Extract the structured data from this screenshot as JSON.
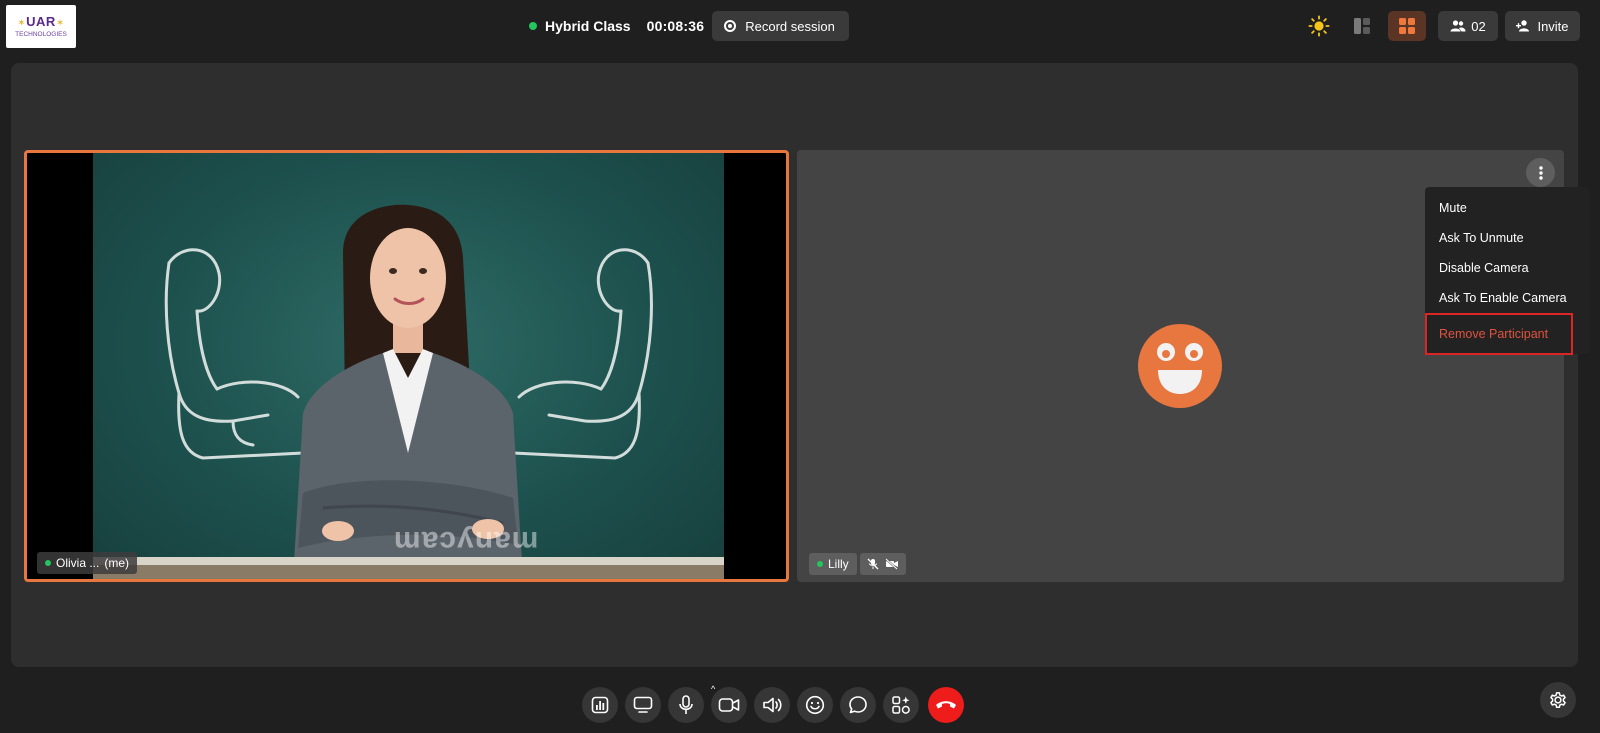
{
  "logo": {
    "main": "UAR",
    "sub": "TECHNOLOGIES"
  },
  "header": {
    "class_title": "Hybrid Class",
    "timer": "00:08:36",
    "record_label": "Record session",
    "participant_count": "02",
    "invite_label": "Invite"
  },
  "tiles": {
    "me": {
      "name": "Olivia ...",
      "suffix": "(me)",
      "watermark": "manycam"
    },
    "other": {
      "name": "Lilly"
    }
  },
  "menu": {
    "items": [
      "Mute",
      "Ask To Unmute",
      "Disable Camera",
      "Ask To Enable Camera",
      "Remove Participant"
    ]
  },
  "colors": {
    "accent": "#e8763f",
    "danger": "#e0533f",
    "live": "#22c55e",
    "end_call": "#ef1c1c"
  },
  "icons": {
    "theme": "sun-icon",
    "layout_side": "sidebar-layout-icon",
    "layout_grid": "grid-layout-icon",
    "participants": "people-icon",
    "invite": "add-user-icon",
    "more": "more-vertical-icon",
    "settings": "gear-icon"
  }
}
